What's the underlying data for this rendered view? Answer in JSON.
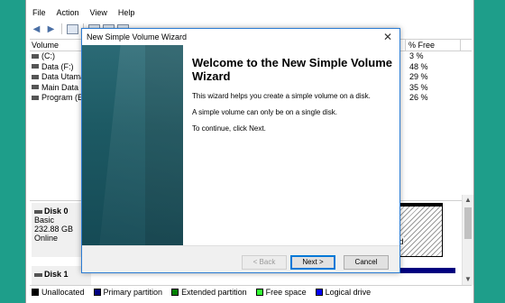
{
  "menubar": {
    "file": "File",
    "action": "Action",
    "view": "View",
    "help": "Help"
  },
  "volumes": {
    "header_volume": "Volume",
    "header_free": "% Free",
    "rows": [
      {
        "name": "(C:)",
        "free": "3 %",
        "extra": ""
      },
      {
        "name": "Data (F:)",
        "free": "48 %",
        "extra": ""
      },
      {
        "name": "Data Utama",
        "free": "29 %",
        "extra": "8"
      },
      {
        "name": "Main Data (D",
        "free": "35 %",
        "extra": ""
      },
      {
        "name": "Program (E:)",
        "free": "26 %",
        "extra": ""
      }
    ]
  },
  "disks": {
    "disk0": {
      "name": "Disk 0",
      "type": "Basic",
      "size": "232.88 GB",
      "status": "Online"
    },
    "disk1": {
      "name": "Disk 1"
    },
    "partition_fragment": "ted"
  },
  "legend": [
    {
      "label": "Unallocated",
      "color": "#000000"
    },
    {
      "label": "Primary partition",
      "color": "#00007f"
    },
    {
      "label": "Extended partition",
      "color": "#008000"
    },
    {
      "label": "Free space",
      "color": "#33ff33"
    },
    {
      "label": "Logical drive",
      "color": "#0000ff"
    }
  ],
  "dialog": {
    "title": "New Simple Volume Wizard",
    "close": "✕",
    "heading": "Welcome to the New Simple Volume Wizard",
    "para1": "This wizard helps you create a simple volume on a disk.",
    "para2": "A simple volume can only be on a single disk.",
    "para3": "To continue, click Next.",
    "back": "< Back",
    "next": "Next >",
    "cancel": "Cancel"
  }
}
